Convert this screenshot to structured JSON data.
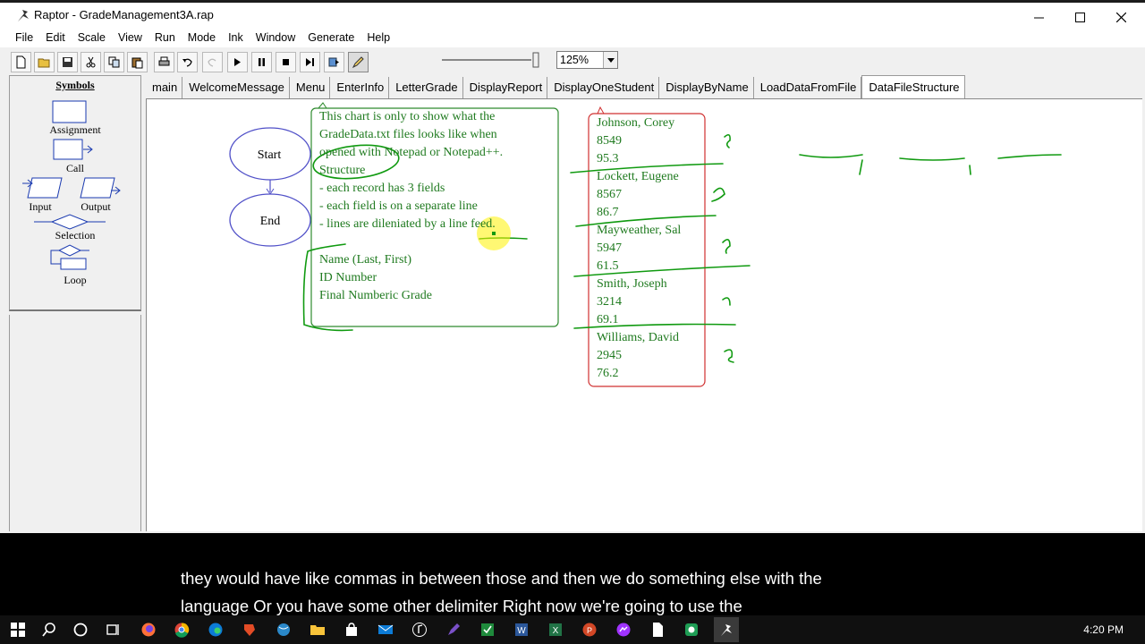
{
  "window": {
    "title": "Raptor - GradeManagement3A.rap"
  },
  "menu": [
    "File",
    "Edit",
    "Scale",
    "View",
    "Run",
    "Mode",
    "Ink",
    "Window",
    "Generate",
    "Help"
  ],
  "toolbar": {
    "zoom_value": "125%",
    "tools": [
      "new-file-icon",
      "open-folder-icon",
      "save-icon",
      "cut-icon",
      "copy-icon",
      "paste-icon",
      "print-icon",
      "undo-icon",
      "redo-icon",
      "play-icon",
      "pause-icon",
      "stop-icon",
      "step-icon",
      "step-into-icon",
      "pen-icon"
    ]
  },
  "symbols": {
    "heading": "Symbols",
    "assignment": "Assignment",
    "call": "Call",
    "input": "Input",
    "output": "Output",
    "selection": "Selection",
    "loop": "Loop"
  },
  "tabs": [
    "main",
    "WelcomeMessage",
    "Menu",
    "EnterInfo",
    "LetterGrade",
    "DisplayReport",
    "DisplayOneStudent",
    "DisplayByName",
    "LoadDataFromFile",
    "DataFileStructure"
  ],
  "active_tab": "DataFileStructure",
  "flowchart": {
    "start": "Start",
    "end": "End"
  },
  "comment": {
    "lines": [
      "This chart is only to show what the",
      "GradeData.txt files looks like when",
      "opened with Notepad or Notepad++.",
      "Structure",
      "    - each record has 3 fields",
      "    - each field is on a separate line",
      "    - lines are dileniated by a line feed.",
      "",
      "Name  (Last, First)",
      "ID Number",
      "Final Numberic Grade"
    ]
  },
  "records": [
    {
      "name": "Johnson, Corey",
      "id": "8549",
      "grade": "95.3"
    },
    {
      "name": "Lockett, Eugene",
      "id": "8567",
      "grade": "86.7"
    },
    {
      "name": "Mayweather, Sal",
      "id": "5947",
      "grade": "61.5"
    },
    {
      "name": "Smith, Joseph",
      "id": "3214",
      "grade": "69.1"
    },
    {
      "name": "Williams, David",
      "id": "2945",
      "grade": "76.2"
    }
  ],
  "caption": {
    "line1": "they would have like commas in between those and then we do something else with the",
    "line2": "language Or you have some other delimiter Right now we're going to use the"
  },
  "taskbar": {
    "clock": "4:20 PM"
  },
  "colors": {
    "comment_green": "#1f7a1f",
    "comment_border": "#2e8b2e",
    "record_border": "#d03030",
    "ink_green": "#109a10",
    "oval_blue": "#5050c8"
  }
}
